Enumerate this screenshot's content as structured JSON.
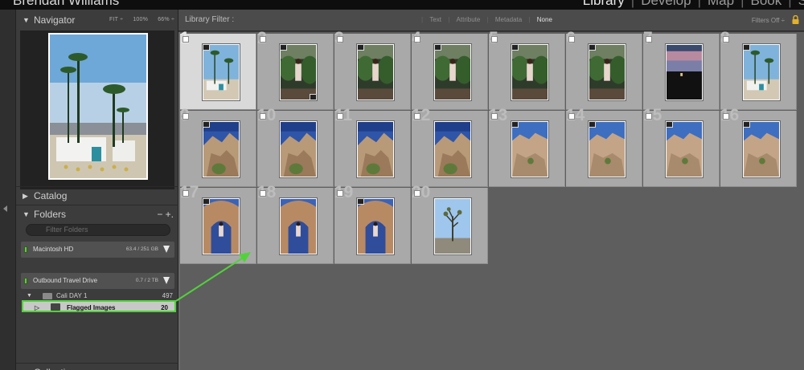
{
  "identity_plate": "Brendan Williams",
  "modules": {
    "items": [
      "Library",
      "Develop",
      "Map",
      "Book",
      "S"
    ],
    "active": "Library"
  },
  "navigator": {
    "title": "Navigator",
    "zoom_options": [
      "FIT ÷",
      "100%",
      "66% ÷"
    ]
  },
  "catalog": {
    "title": "Catalog"
  },
  "folders": {
    "title": "Folders",
    "actions": "−  +.",
    "search_placeholder": "Filter Folders",
    "volumes": [
      {
        "name": "Macintosh HD",
        "usage": "63.4 / 251 GB"
      },
      {
        "name": "Outbound Travel Drive",
        "usage": "0.7 / 2 TB"
      }
    ],
    "tree": {
      "parent": {
        "name": "Cali DAY 1",
        "count": "497"
      },
      "child": {
        "name": "Flagged Images",
        "count": "20"
      }
    }
  },
  "collections": {
    "title": "Collections"
  },
  "library_filter": {
    "label": "Library Filter :",
    "options": [
      "Text",
      "Attribute",
      "Metadata",
      "None"
    ],
    "active": "None",
    "filters_off": "Filters Off ÷"
  },
  "grid": {
    "cells": [
      {
        "num": "1",
        "scene": "palm",
        "badge": true
      },
      {
        "num": "2",
        "scene": "green",
        "badge": true,
        "badge2": true
      },
      {
        "num": "3",
        "scene": "green",
        "badge": true
      },
      {
        "num": "4",
        "scene": "green",
        "badge": true
      },
      {
        "num": "5",
        "scene": "green",
        "badge": true
      },
      {
        "num": "6",
        "scene": "green",
        "badge": true
      },
      {
        "num": "7",
        "scene": "dusk",
        "badge": false
      },
      {
        "num": "8",
        "scene": "palm",
        "badge": true
      },
      {
        "num": "9",
        "scene": "desert",
        "badge": true
      },
      {
        "num": "10",
        "scene": "desert",
        "badge": false
      },
      {
        "num": "11",
        "scene": "desert",
        "badge": false
      },
      {
        "num": "12",
        "scene": "desert",
        "badge": false
      },
      {
        "num": "13",
        "scene": "rocks",
        "badge": true
      },
      {
        "num": "14",
        "scene": "rocks",
        "badge": true
      },
      {
        "num": "15",
        "scene": "rocks",
        "badge": true
      },
      {
        "num": "16",
        "scene": "rocks",
        "badge": true
      },
      {
        "num": "17",
        "scene": "arch",
        "badge": true
      },
      {
        "num": "18",
        "scene": "arch",
        "badge": false
      },
      {
        "num": "19",
        "scene": "arch",
        "badge": true
      },
      {
        "num": "20",
        "scene": "joshua",
        "badge": false
      }
    ]
  },
  "colors": {
    "annotation_green": "#52d23a",
    "selected_cell": "#d9d9d9",
    "panel_bg": "#3c3c3c"
  }
}
